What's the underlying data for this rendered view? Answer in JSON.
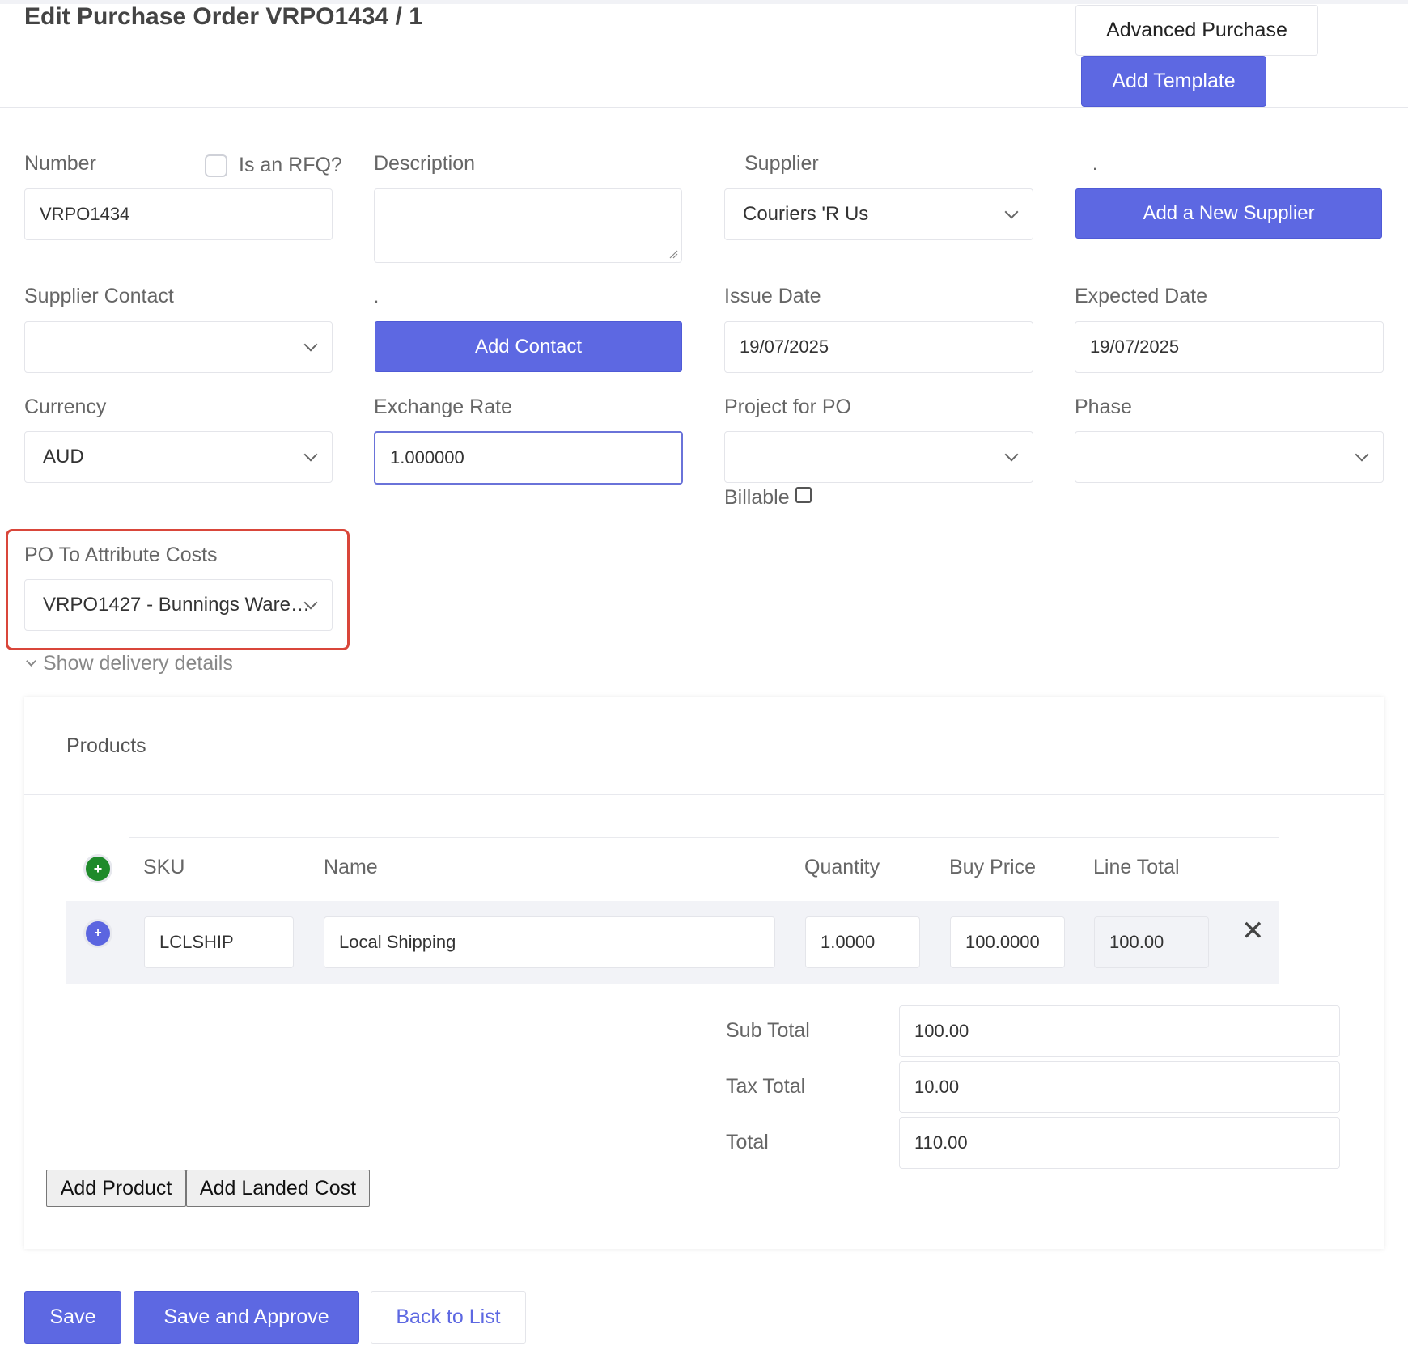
{
  "header": {
    "title": "Edit Purchase Order VRPO1434 / 1",
    "advanced_purchase": "Advanced Purchase",
    "add_template": "Add Template"
  },
  "form": {
    "number_label": "Number",
    "number_value": "VRPO1434",
    "rfq_label": "Is an RFQ?",
    "description_label": "Description",
    "description_value": "",
    "supplier_label": "Supplier",
    "supplier_value": "Couriers 'R Us",
    "dot": ".",
    "add_supplier": "Add a New Supplier",
    "supplier_contact_label": "Supplier Contact",
    "supplier_contact_value": "",
    "add_contact": "Add Contact",
    "issue_date_label": "Issue Date",
    "issue_date_value": "19/07/2025",
    "expected_date_label": "Expected Date",
    "expected_date_value": "19/07/2025",
    "currency_label": "Currency",
    "currency_value": "AUD",
    "exchange_rate_label": "Exchange Rate",
    "exchange_rate_value": "1.000000",
    "project_label": "Project for PO",
    "project_value": "",
    "billable_label": "Billable",
    "phase_label": "Phase",
    "phase_value": "",
    "po_attr_label": "PO To Attribute Costs",
    "po_attr_value": "VRPO1427 - Bunnings Ware…",
    "show_delivery": "Show delivery details"
  },
  "products": {
    "title": "Products",
    "columns": [
      "SKU",
      "Name",
      "Quantity",
      "Buy Price",
      "Line Total"
    ],
    "rows": [
      {
        "sku": "LCLSHIP",
        "name": "Local Shipping",
        "quantity": "1.0000",
        "buy_price": "100.0000",
        "line_total": "100.00"
      }
    ],
    "sub_total_label": "Sub Total",
    "sub_total_value": "100.00",
    "tax_total_label": "Tax Total",
    "tax_total_value": "10.00",
    "total_label": "Total",
    "total_value": "110.00",
    "add_product": "Add Product",
    "add_landed_cost": "Add Landed Cost"
  },
  "footer": {
    "save": "Save",
    "save_approve": "Save and Approve",
    "back": "Back to List"
  },
  "icons": {
    "add_row": "plus-circle-icon",
    "row_detail": "plus-circle-icon",
    "remove": "close-icon",
    "chevron": "chevron-down-icon"
  },
  "colors": {
    "primary": "#5d68e2",
    "highlight": "#d9463a",
    "add_icon": "#1e8a2a"
  }
}
